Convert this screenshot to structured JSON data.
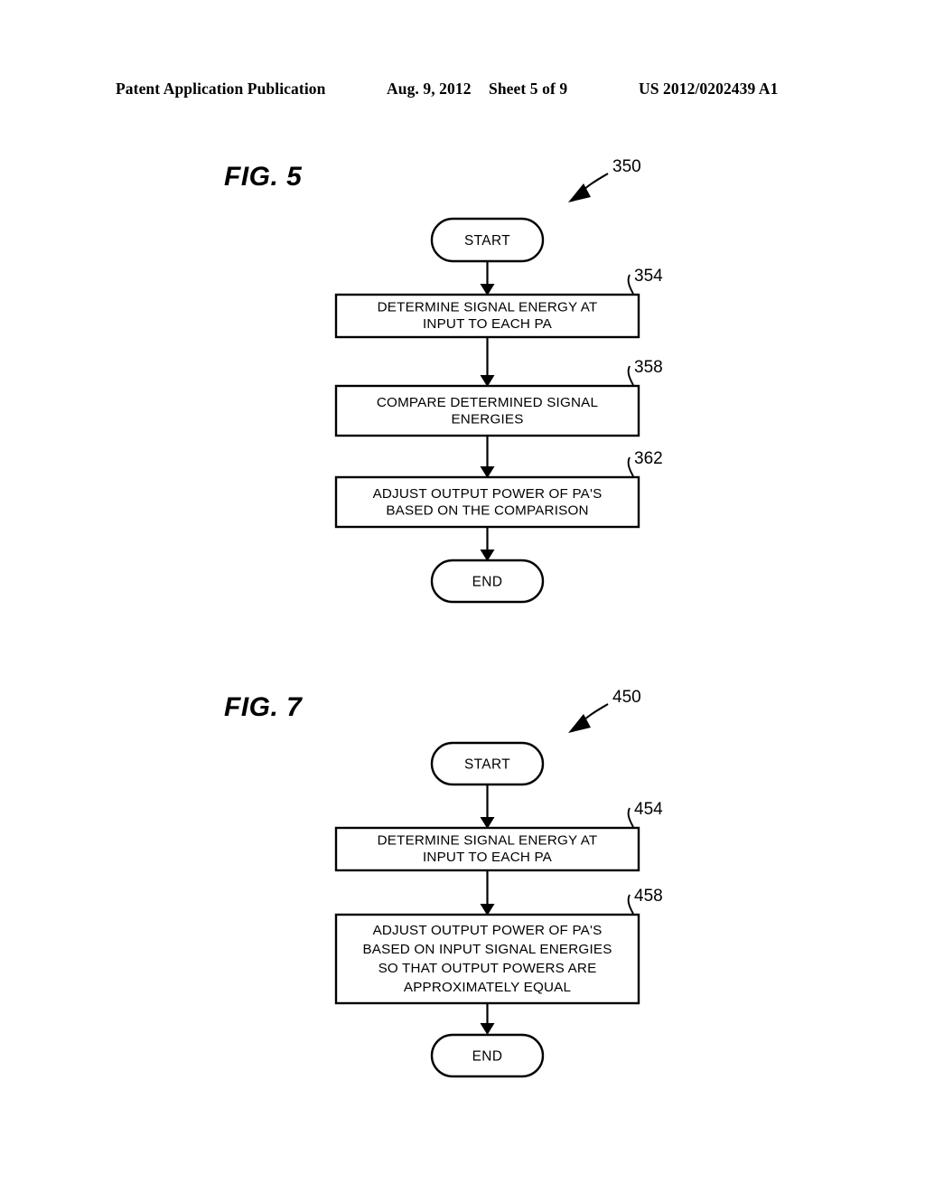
{
  "header": {
    "publication": "Patent Application Publication",
    "date": "Aug. 9, 2012",
    "sheet": "Sheet 5 of 9",
    "patent_number": "US 2012/0202439 A1"
  },
  "figures": [
    {
      "label": "FIG. 5",
      "ref": "350",
      "nodes": [
        {
          "kind": "terminal",
          "name": "start",
          "text": "START"
        },
        {
          "kind": "process",
          "name": "determine-signal-energy",
          "ref": "354",
          "lines": [
            "DETERMINE SIGNAL ENERGY AT",
            "INPUT TO EACH PA"
          ]
        },
        {
          "kind": "process",
          "name": "compare-energies",
          "ref": "358",
          "lines": [
            "COMPARE DETERMINED SIGNAL",
            "ENERGIES"
          ]
        },
        {
          "kind": "process",
          "name": "adjust-output-power",
          "ref": "362",
          "lines": [
            "ADJUST OUTPUT POWER OF PA'S",
            "BASED ON THE COMPARISON"
          ]
        },
        {
          "kind": "terminal",
          "name": "end",
          "text": "END"
        }
      ]
    },
    {
      "label": "FIG. 7",
      "ref": "450",
      "nodes": [
        {
          "kind": "terminal",
          "name": "start",
          "text": "START"
        },
        {
          "kind": "process",
          "name": "determine-signal-energy",
          "ref": "454",
          "lines": [
            "DETERMINE SIGNAL ENERGY AT",
            "INPUT TO EACH PA"
          ]
        },
        {
          "kind": "process",
          "name": "adjust-output-power",
          "ref": "458",
          "lines": [
            "ADJUST OUTPUT POWER OF PA'S",
            "BASED ON INPUT SIGNAL ENERGIES",
            "SO THAT OUTPUT POWERS ARE",
            "APPROXIMATELY EQUAL"
          ]
        },
        {
          "kind": "terminal",
          "name": "end",
          "text": "END"
        }
      ]
    }
  ],
  "colors": {
    "ink": "#000000",
    "paper": "#ffffff"
  }
}
